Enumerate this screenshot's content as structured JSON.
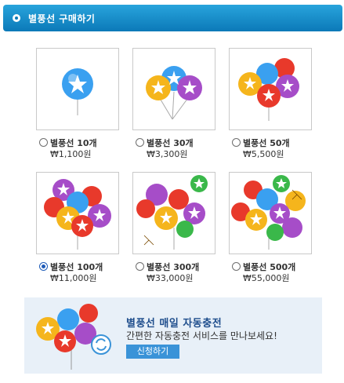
{
  "header": {
    "title": "별풍선 구매하기"
  },
  "items": [
    {
      "label": "별풍선 10개",
      "price": "₩1,100원",
      "selected": false
    },
    {
      "label": "별풍선 30개",
      "price": "₩3,300원",
      "selected": false
    },
    {
      "label": "별풍선 50개",
      "price": "₩5,500원",
      "selected": false
    },
    {
      "label": "별풍선 100개",
      "price": "₩11,000원",
      "selected": true
    },
    {
      "label": "별풍선 300개",
      "price": "₩33,000원",
      "selected": false
    },
    {
      "label": "별풍선 500개",
      "price": "₩55,000원",
      "selected": false
    }
  ],
  "banner": {
    "title": "별풍선 매일 자동충전",
    "subtitle": "간편한 자동충전 서비스를 만나보세요!",
    "button": "신청하기"
  },
  "colors": {
    "header": "#0b79b8",
    "balloon_blue": "#3aa0f0",
    "balloon_yellow": "#f5b51c",
    "balloon_purple": "#a64dc8",
    "balloon_red": "#e8392b",
    "balloon_green": "#3ab84a",
    "banner_bg": "#e8f0f8",
    "button": "#3a93d8"
  }
}
